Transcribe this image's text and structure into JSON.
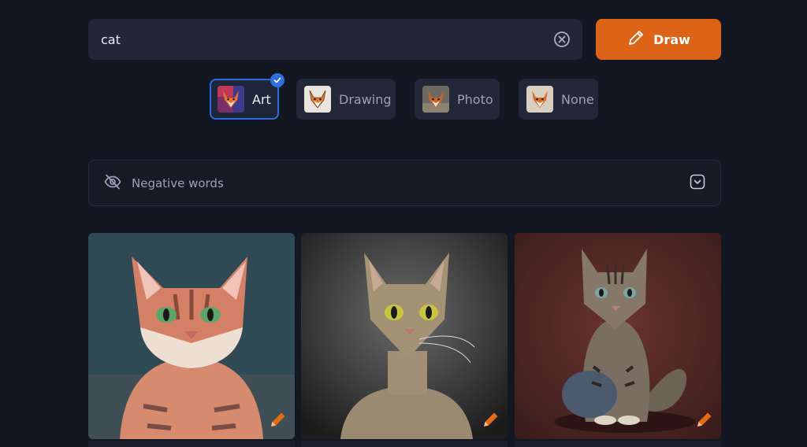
{
  "search": {
    "value": "cat",
    "placeholder": ""
  },
  "draw_button": {
    "label": "Draw"
  },
  "styles": [
    {
      "label": "Art",
      "selected": true
    },
    {
      "label": "Drawing",
      "selected": false
    },
    {
      "label": "Photo",
      "selected": false
    },
    {
      "label": "None",
      "selected": false
    }
  ],
  "negative_words": {
    "label": "Negative words"
  },
  "results": [
    {
      "icon": "edit-pencil-icon"
    },
    {
      "icon": "edit-pencil-icon"
    },
    {
      "icon": "edit-pencil-icon"
    }
  ],
  "colors": {
    "accent": "#dd6416",
    "selected_border": "#2d6cdf",
    "background": "#131722"
  }
}
